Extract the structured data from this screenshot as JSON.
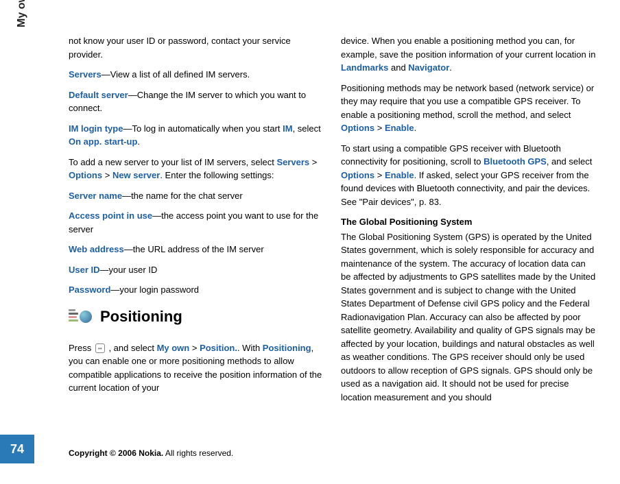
{
  "sidebar": {
    "label": "My own",
    "page_number": "74"
  },
  "col1": {
    "para0": "not know your user ID or password, contact your service provider.",
    "para1_link": "Servers",
    "para1_rest": "—View a list of all defined IM servers.",
    "para2_link": "Default server",
    "para2_rest": "—Change the IM server to which you want to connect.",
    "para3_link1": "IM login type",
    "para3_mid1": "—To log in automatically when you start ",
    "para3_link2": "IM",
    "para3_mid2": ", select ",
    "para3_link3": "On app. start-up",
    "para3_end": ".",
    "para4_pre": "To add a new server to your list of IM servers, select ",
    "para4_link1": "Servers",
    "para4_sep1": " > ",
    "para4_link2": "Options",
    "para4_sep2": " > ",
    "para4_link3": "New server",
    "para4_end": ". Enter the following settings:",
    "para5_link": "Server name",
    "para5_rest": "—the name for the chat server",
    "para6_link": "Access point in use",
    "para6_rest": "—the access point you want to use for the server",
    "para7_link": "Web address",
    "para7_rest": "—the URL address of the IM server",
    "para8_link": "User ID",
    "para8_rest": "—your user ID",
    "para9_link": "Password",
    "para9_rest": "—your login password",
    "heading": "Positioning",
    "para10_pre": "Press ",
    "para10_mid1": " , and select ",
    "para10_link1": "My own",
    "para10_sep1": " > ",
    "para10_link2": "Position.",
    "para10_mid2": ". With ",
    "para10_link3": "Positioning",
    "para10_end": ", you can enable one or more positioning methods to allow compatible applications to receive the position information of the current location of your"
  },
  "col2": {
    "para0_pre": "device. When you enable a positioning method you can, for example, save the position information of your current location in ",
    "para0_link1": "Landmarks",
    "para0_mid": " and ",
    "para0_link2": "Navigator",
    "para0_end": ".",
    "para1_pre": "Positioning methods may be network based (network service) or they may require that you use a compatible GPS receiver. To enable a positioning method, scroll the method, and select ",
    "para1_link1": "Options",
    "para1_sep": " > ",
    "para1_link2": "Enable",
    "para1_end": ".",
    "para2_pre": "To start using a compatible GPS receiver with Bluetooth connectivity for positioning, scroll to ",
    "para2_link1": "Bluetooth GPS",
    "para2_mid1": ", and select ",
    "para2_link2": "Options",
    "para2_sep": " > ",
    "para2_link3": "Enable",
    "para2_end": ". If asked, select your GPS receiver from the found devices with Bluetooth connectivity, and pair the devices. See \"Pair devices\", p. 83.",
    "subheading": "The Global Positioning System",
    "para3": "The Global Positioning System (GPS) is operated by the United States government, which is solely responsible for accuracy and maintenance of the system. The accuracy of location data can be affected by adjustments to GPS satellites made by the United States government and is subject to change with the United States Department of Defense civil GPS policy and the Federal Radionavigation Plan. Accuracy can also be affected by poor satellite geometry. Availability and quality of GPS signals may be affected by your location, buildings and natural obstacles as well as weather conditions. The GPS receiver should only be used outdoors to allow reception of GPS signals. GPS should only be used as a navigation aid. It should not be used for precise location measurement and you should"
  },
  "copyright": {
    "bold": "Copyright © 2006 Nokia.",
    "rest": " All rights reserved."
  }
}
